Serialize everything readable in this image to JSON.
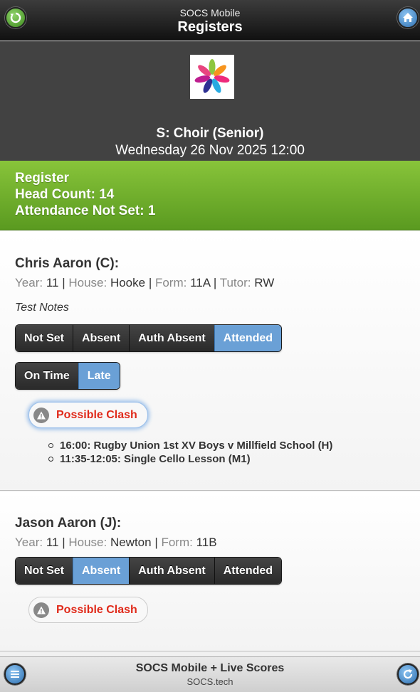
{
  "header": {
    "app_name": "SOCS Mobile",
    "title": "Registers"
  },
  "event": {
    "name": "S: Choir (Senior)",
    "datetime": "Wednesday 26 Nov 2025 12:00"
  },
  "summary": {
    "label": "Register",
    "head_count": "Head Count: 14",
    "attendance_not_set": "Attendance Not Set: 1"
  },
  "students": [
    {
      "name": "Chris Aaron (C):",
      "year_label": "Year:",
      "year": "11",
      "house_label": "House:",
      "house": "Hooke",
      "form_label": "Form:",
      "form": "11A",
      "tutor_label": "Tutor:",
      "tutor": "RW",
      "notes": "Test Notes",
      "attendance_options": [
        "Not Set",
        "Absent",
        "Auth Absent",
        "Attended"
      ],
      "attendance_selected": "Attended",
      "timing_options": [
        "On Time",
        "Late"
      ],
      "timing_selected": "Late",
      "clash_label": "Possible Clash",
      "clashes": [
        "16:00: Rugby Union 1st XV Boys v Millfield School (H)",
        "11:35-12:05: Single Cello Lesson (M1)"
      ]
    },
    {
      "name": "Jason Aaron (J):",
      "year_label": "Year:",
      "year": "11",
      "house_label": "House:",
      "house": "Newton",
      "form_label": "Form:",
      "form": "11B",
      "attendance_options": [
        "Not Set",
        "Absent",
        "Auth Absent",
        "Attended"
      ],
      "attendance_selected": "Absent",
      "clash_label": "Possible Clash"
    }
  ],
  "footer": {
    "title": "SOCS Mobile + Live Scores",
    "subtitle": "SOCS.tech"
  },
  "icons": {
    "back": "back-arrow-icon",
    "home": "home-icon",
    "menu": "menu-icon",
    "refresh": "refresh-icon",
    "warning": "warning-icon",
    "logo": "pinwheel-logo"
  },
  "colors": {
    "selected": "#6aa0d6",
    "summary_green": "#72b02c",
    "clash_red": "#e02a1a"
  }
}
